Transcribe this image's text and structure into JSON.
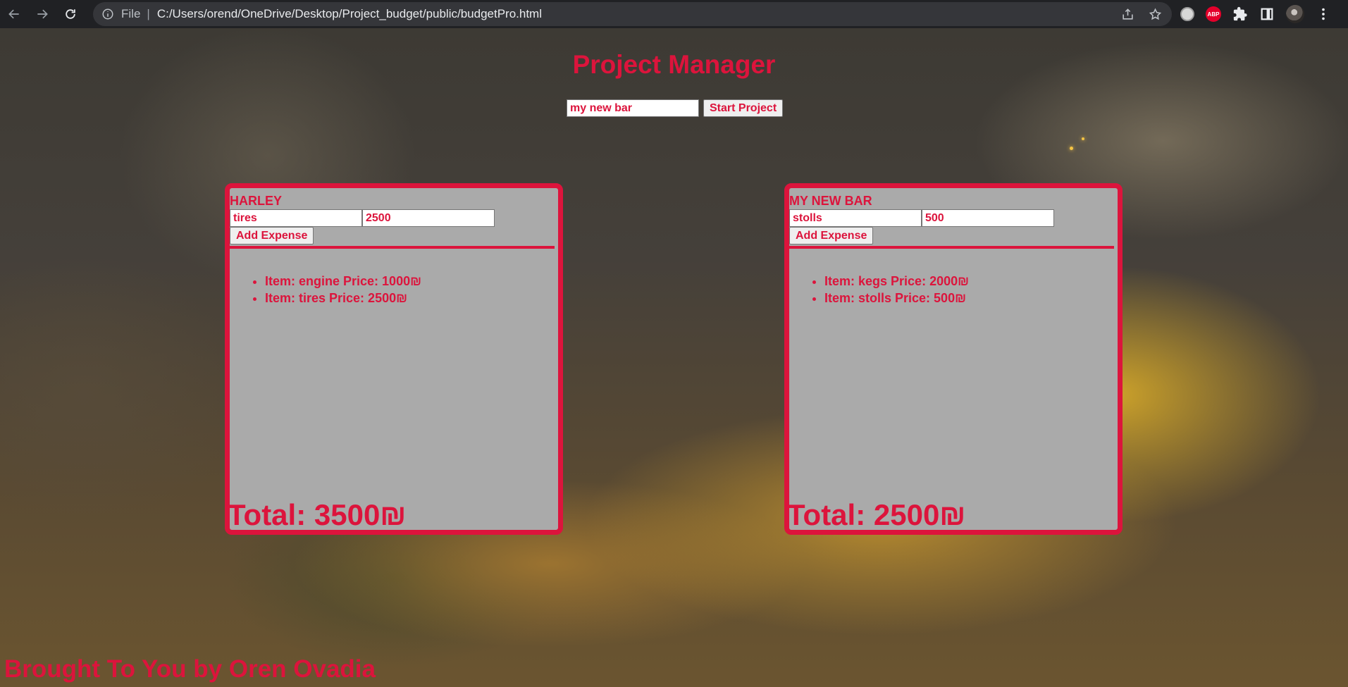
{
  "browser": {
    "scheme": "File",
    "url": "C:/Users/orend/OneDrive/Desktop/Project_budget/public/budgetPro.html",
    "extension_abp_label": "ABP"
  },
  "page": {
    "title": "Project Manager",
    "new_project_value": "my new bar",
    "start_button_label": "Start Project",
    "footer": "Brought To You by Oren Ovadia"
  },
  "projects": [
    {
      "name": "HARLEY",
      "item_value": "tires",
      "price_value": "2500",
      "add_button_label": "Add Expense",
      "expenses": [
        "Item: engine Price: 1000₪",
        "Item: tires Price: 2500₪"
      ],
      "total": "Total: 3500₪"
    },
    {
      "name": "MY NEW BAR",
      "item_value": "stolls",
      "price_value": "500",
      "add_button_label": "Add Expense",
      "expenses": [
        "Item: kegs Price: 2000₪",
        "Item: stolls Price: 500₪"
      ],
      "total": "Total: 2500₪"
    }
  ],
  "colors": {
    "accent": "#dc143c",
    "card_background": "#aaaaaa",
    "chrome_background": "#202124"
  }
}
